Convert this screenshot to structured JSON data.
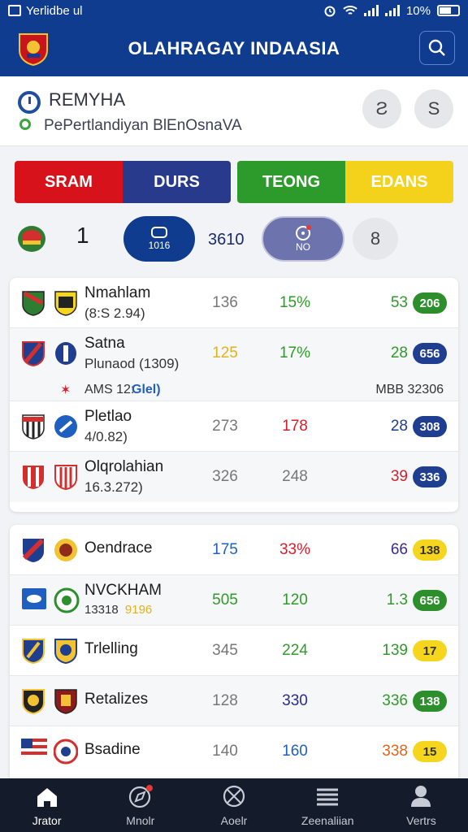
{
  "status_bar": {
    "left_text": "Yerlidbe ul",
    "battery": "10%"
  },
  "header": {
    "title": "OLAHRAGAY INDAASIA"
  },
  "subheader": {
    "title": "REMYHA",
    "subtitle": "PePertlandiyan BlEnOsnaVA",
    "btn1": "Ƨ",
    "btn2": "S"
  },
  "segments": {
    "left": [
      {
        "label": "SRAM",
        "bg": "#d8121b",
        "fg": "#ffffff"
      },
      {
        "label": "DURS",
        "bg": "#283a8c",
        "fg": "#ffffff"
      }
    ],
    "right": [
      {
        "label": "TEONG",
        "bg": "#2d9b2b",
        "fg": "#ffffff"
      },
      {
        "label": "EDANS",
        "bg": "#f4d21c",
        "fg": "#ffffff"
      }
    ]
  },
  "controls": {
    "number": "1",
    "pill1": "1016",
    "mid_value": "3610",
    "pill2": "NO",
    "last": "8"
  },
  "table1": {
    "rows": [
      {
        "name": "Nmahlam",
        "sub": "(8:S 2.94)",
        "c1": "136",
        "c2": "15%",
        "c2_color": "#2f9a2a",
        "c3": "53",
        "c3_color": "#2f9a2a",
        "pill": "206",
        "pill_bg": "#2d8f2c",
        "pill_fg": "#ffffff"
      },
      {
        "name": "Satna",
        "sub": "Plunaod (1309)",
        "c1": "125",
        "c1_color": "#e0b21b",
        "c2": "17%",
        "c2_color": "#2f9a2a",
        "c3": "28",
        "c3_color": "#2f9a2a",
        "pill": "656",
        "pill_bg": "#1f3e8f",
        "pill_fg": "#ffffff"
      },
      {
        "note_left": "AMS 12:",
        "note_mid": "Glel)",
        "note_right": "MBB 32306"
      },
      {
        "name": "Pletlao",
        "sub": "4/0.82)",
        "c1": "273",
        "c2": "178",
        "c2_color": "#d31e2c",
        "c3": "28",
        "c3_color": "#1f3e8f",
        "pill": "308",
        "pill_bg": "#1f3e8f",
        "pill_fg": "#ffffff"
      },
      {
        "name": "Olqrolahian",
        "sub": "16.3.272)",
        "c1": "326",
        "c2": "248",
        "c2_color": "#777777",
        "c3": "39",
        "c3_color": "#d31e2c",
        "pill": "336",
        "pill_bg": "#1f3e8f",
        "pill_fg": "#ffffff"
      }
    ]
  },
  "table2": {
    "rows": [
      {
        "name": "Oendrace",
        "c1": "175",
        "c1_color": "#1f5fbf",
        "c2": "33%",
        "c2_color": "#d31e2c",
        "c3": "66",
        "c3_color": "#3a2a8f",
        "pill": "138",
        "pill_bg": "#f6d51e",
        "pill_fg": "#333333"
      },
      {
        "name": "NVCKHAM",
        "sub": "13318",
        "sub2": "9196",
        "c1": "505",
        "c1_color": "#2f9a2a",
        "c2": "120",
        "c2_color": "#2f9a2a",
        "c3": "1.3",
        "c3_color": "#2f9a2a",
        "pill": "656",
        "pill_bg": "#2d8f2c",
        "pill_fg": "#ffffff"
      },
      {
        "name": "Trlelling",
        "c1": "345",
        "c2": "224",
        "c2_color": "#2f9a2a",
        "c3": "139",
        "c3_color": "#2f9a2a",
        "pill": "17",
        "pill_bg": "#f6d51e",
        "pill_fg": "#333333"
      },
      {
        "name": "Retalizes",
        "c1": "128",
        "c2": "330",
        "c2_color": "#2a2a8f",
        "c3": "336",
        "c3_color": "#2f9a2a",
        "pill": "138",
        "pill_bg": "#2d8f2c",
        "pill_fg": "#ffffff"
      },
      {
        "name": "Bsadine",
        "c1": "140",
        "c2": "160",
        "c2_color": "#1f5fbf",
        "c3": "338",
        "c3_color": "#e0651b",
        "pill": "15",
        "pill_bg": "#f6d51e",
        "pill_fg": "#333333"
      }
    ]
  },
  "tabs": [
    {
      "label": "Jrator",
      "icon": "home-icon"
    },
    {
      "label": "Mnolr",
      "icon": "compass-icon"
    },
    {
      "label": "Aoelr",
      "icon": "ball-icon"
    },
    {
      "label": "Zeenaliian",
      "icon": "list-icon"
    },
    {
      "label": "Vertrs",
      "icon": "user-icon"
    }
  ]
}
